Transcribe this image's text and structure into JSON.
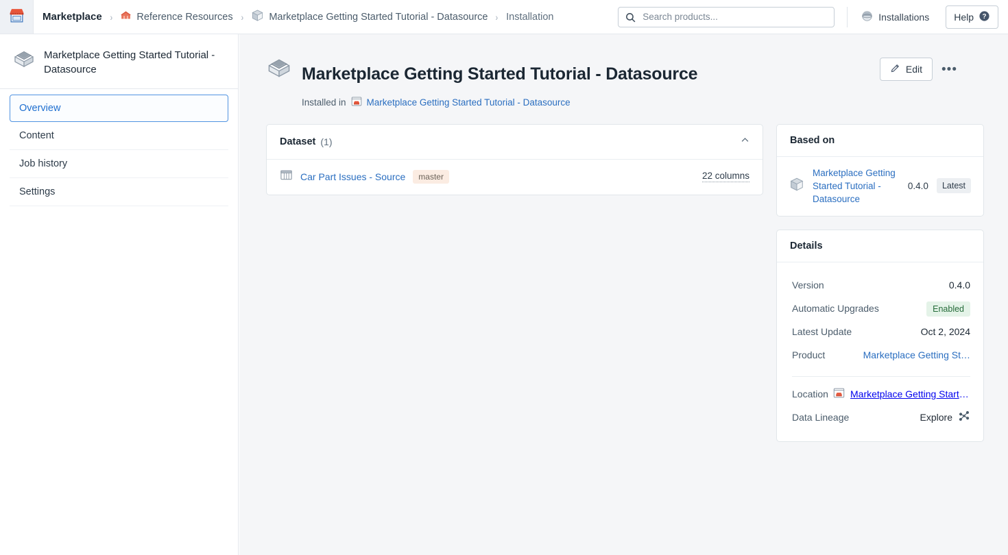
{
  "topbar": {
    "logo_icon": "marketplace-storefront-icon",
    "breadcrumb": [
      {
        "label": "Marketplace",
        "icon": null
      },
      {
        "label": "Reference Resources",
        "icon": "barn-icon"
      },
      {
        "label": "Marketplace Getting Started Tutorial - Datasource",
        "icon": "package-cube-icon"
      },
      {
        "label": "Installation",
        "icon": null
      }
    ],
    "separator": "›",
    "search": {
      "placeholder": "Search products...",
      "value": "",
      "icon": "search-icon"
    },
    "installations_label": "Installations",
    "installations_icon": "datasource-disc-icon",
    "help_label": "Help",
    "help_icon": "question-circle-icon"
  },
  "sidebar": {
    "header_title": "Marketplace Getting Started Tutorial - Datasource",
    "header_icon": "datasource-box-icon",
    "items": [
      {
        "label": "Overview",
        "active": true
      },
      {
        "label": "Content",
        "active": false
      },
      {
        "label": "Job history",
        "active": false
      },
      {
        "label": "Settings",
        "active": false
      }
    ]
  },
  "page": {
    "icon": "datasource-box-icon",
    "title": "Marketplace Getting Started Tutorial - Datasource",
    "installed_in_label": "Installed in",
    "installed_in_icon": "marketplace-window-icon",
    "installed_in_link": "Marketplace Getting Started Tutorial - Datasource",
    "edit_label": "Edit",
    "edit_icon": "pencil-icon",
    "more_label": "•••"
  },
  "dataset_card": {
    "title": "Dataset",
    "count": "(1)",
    "collapse_icon": "chevron-up-icon",
    "rows": [
      {
        "icon": "table-icon",
        "name": "Car Part Issues - Source",
        "branch": "master",
        "columns": "22 columns"
      }
    ]
  },
  "based_on_card": {
    "title": "Based on",
    "icon": "package-cube-icon",
    "name": "Marketplace Getting Started Tutorial - Datasource",
    "version": "0.4.0",
    "badge": "Latest"
  },
  "details_card": {
    "title": "Details",
    "rows": [
      {
        "label": "Version",
        "value": "0.4.0",
        "type": "text"
      },
      {
        "label": "Automatic Upgrades",
        "value": "Enabled",
        "type": "badge-green"
      },
      {
        "label": "Latest Update",
        "value": "Oct 2, 2024",
        "type": "text"
      },
      {
        "label": "Product",
        "value": "Marketplace Getting St…",
        "type": "link"
      }
    ],
    "location_label": "Location",
    "location_value": "Marketplace Getting Started…",
    "location_icon": "marketplace-window-icon",
    "lineage_label": "Data Lineage",
    "lineage_value": "Explore",
    "lineage_icon": "lineage-graph-icon"
  },
  "colors": {
    "brand_orange": "#e8563a",
    "link_blue": "#2a6ec0",
    "accent_blue": "#5093e1",
    "badge_master_bg": "#fbece2",
    "badge_enabled_bg": "#e4f3e8",
    "badge_enabled_text": "#256b39",
    "main_bg": "#f5f6f8"
  }
}
